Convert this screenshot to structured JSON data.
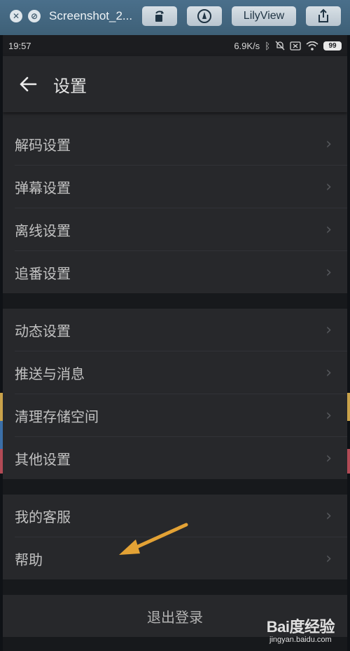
{
  "viewer": {
    "title": "Screenshot_2...",
    "buttons": {
      "lilyview": "LilyView"
    }
  },
  "status_bar": {
    "time": "19:57",
    "speed": "6.9K/s",
    "battery": "99"
  },
  "header": {
    "title": "设置"
  },
  "groups": [
    {
      "items": [
        {
          "label": "解码设置"
        },
        {
          "label": "弹幕设置"
        },
        {
          "label": "离线设置"
        },
        {
          "label": "追番设置"
        }
      ]
    },
    {
      "items": [
        {
          "label": "动态设置"
        },
        {
          "label": "推送与消息"
        },
        {
          "label": "清理存储空间"
        },
        {
          "label": "其他设置"
        }
      ]
    },
    {
      "items": [
        {
          "label": "我的客服"
        },
        {
          "label": "帮助"
        }
      ]
    }
  ],
  "logout": {
    "label": "退出登录"
  },
  "watermark": {
    "logo": "Bai度经验",
    "url": "jingyan.baidu.com"
  },
  "colors": {
    "annotation_arrow": "#e3a235",
    "surface": "#27282b",
    "background": "#17191c"
  }
}
